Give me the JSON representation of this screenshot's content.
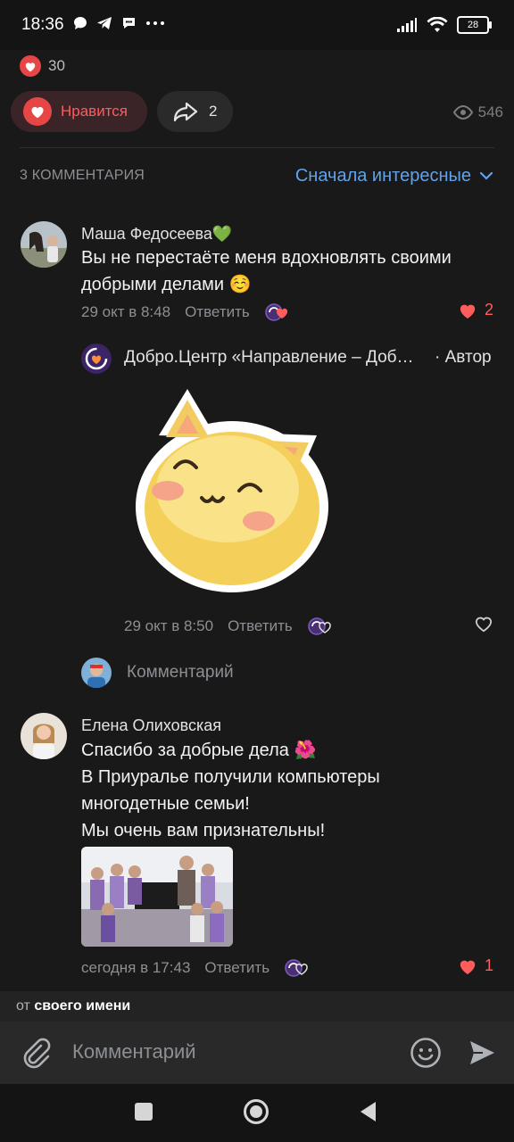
{
  "status_bar": {
    "time": "18:36",
    "battery": "28"
  },
  "post": {
    "likes_count": "30",
    "like_label": "Нравится",
    "shares_count": "2",
    "views_count": "546"
  },
  "comments_header": {
    "count_label": "3 КОММЕНТАРИЯ",
    "sort_label": "Сначала интересные"
  },
  "comments": [
    {
      "author": "Маша Федосеева",
      "badge": "💚",
      "text_lines": [
        "Вы не перестаёте меня вдохновлять своими",
        "добрыми делами ☺️"
      ],
      "time": "29 окт в 8:48",
      "reply_label": "Ответить",
      "likes": "2"
    },
    {
      "author": "Добро.Центр «Направление – Доб…",
      "role": "· Автор",
      "time": "29 окт в 8:50",
      "reply_label": "Ответить"
    },
    {
      "author": "Елена Олиховская",
      "text_lines": [
        "Спасибо за добрые дела 🌺",
        "В Приуралье получили компьютеры",
        "многодетные семьи!",
        "Мы очень вам признательны!"
      ],
      "time": "сегодня в 17:43",
      "reply_label": "Ответить",
      "likes": "1"
    }
  ],
  "reply_box": {
    "placeholder": "Комментарий"
  },
  "from_bar": {
    "prefix": "от",
    "name": "своего имени"
  },
  "input": {
    "placeholder": "Комментарий"
  },
  "colors": {
    "accent_blue": "#5fa3ec",
    "like_red": "#e64646",
    "background": "#191919"
  }
}
